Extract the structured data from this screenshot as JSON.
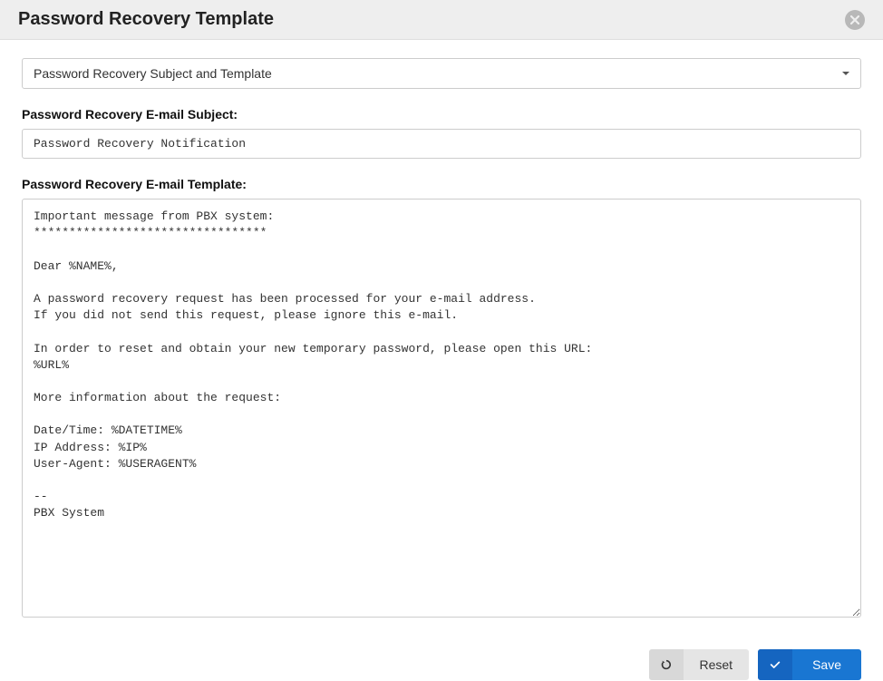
{
  "header": {
    "title": "Password Recovery Template"
  },
  "dropdown": {
    "selected": "Password Recovery Subject and Template"
  },
  "subject": {
    "label": "Password Recovery E-mail Subject:",
    "value": "Password Recovery Notification"
  },
  "template": {
    "label": "Password Recovery E-mail Template:",
    "value": "Important message from PBX system:\n*********************************\n\nDear %NAME%,\n\nA password recovery request has been processed for your e-mail address.\nIf you did not send this request, please ignore this e-mail.\n\nIn order to reset and obtain your new temporary password, please open this URL:\n%URL%\n\nMore information about the request:\n\nDate/Time: %DATETIME%\nIP Address: %IP%\nUser-Agent: %USERAGENT%\n\n--\nPBX System"
  },
  "footer": {
    "reset_label": "Reset",
    "save_label": "Save"
  }
}
